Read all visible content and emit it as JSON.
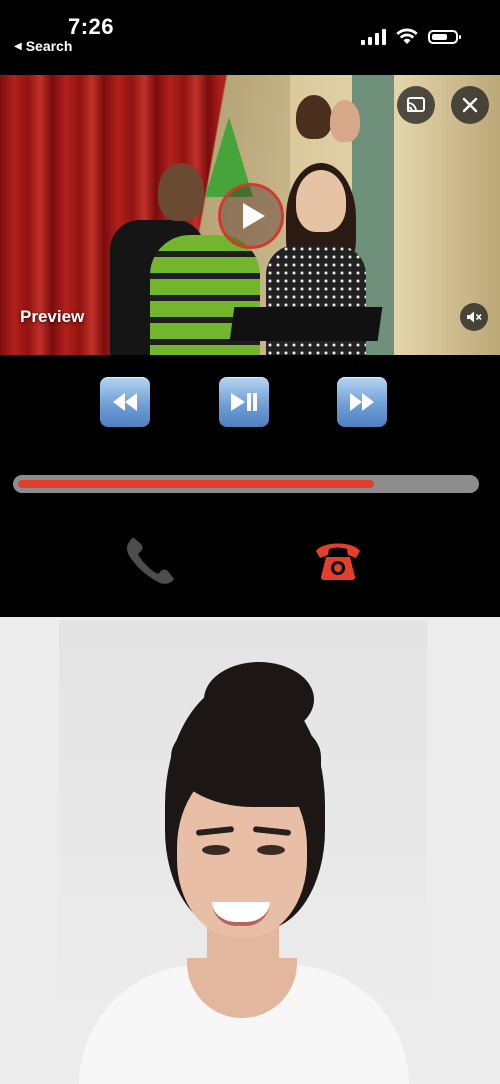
{
  "status_bar": {
    "time": "7:26",
    "back_label": "Search",
    "battery_level": 0.7
  },
  "video": {
    "preview_label": "Preview",
    "icons": {
      "cast": "cast-icon",
      "close": "close-icon",
      "play": "play-icon",
      "mute": "mute-icon"
    }
  },
  "controls": {
    "buttons": [
      "rewind-icon",
      "play-pause-icon",
      "fast-forward-icon"
    ],
    "progress": 0.78,
    "colors": {
      "progress": "#e23f2c",
      "track": "#8d8d8d",
      "hangup": "#e23f2c"
    }
  },
  "call": {
    "icons": [
      "phone-receiver-icon",
      "hang-up-phone-icon"
    ]
  }
}
